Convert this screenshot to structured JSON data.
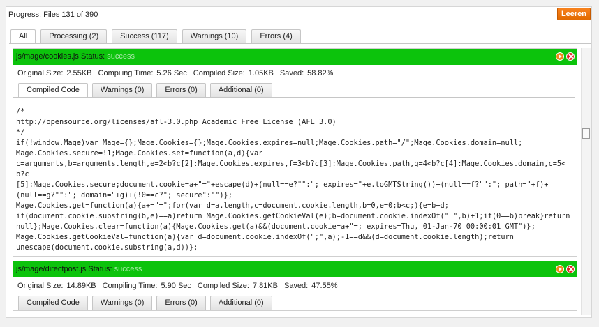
{
  "progress": "Progress: Files 131 of 390",
  "clear_button": "Leeren",
  "main_tabs": [
    {
      "label": "All"
    },
    {
      "label": "Processing (2)"
    },
    {
      "label": "Success (117)"
    },
    {
      "label": "Warnings (10)"
    },
    {
      "label": "Errors (4)"
    }
  ],
  "files": [
    {
      "name": "js/mage/cookies.js",
      "status_label": "Status:",
      "status_value": "success",
      "original_size_label": "Original Size:",
      "original_size": "2.55KB",
      "compiling_time_label": "Compiling Time:",
      "compiling_time": "5.26 Sec",
      "compiled_size_label": "Compiled Size:",
      "compiled_size": "1.05KB",
      "saved_label": "Saved:",
      "saved": "58.82%",
      "tabs": [
        "Compiled Code",
        "Warnings (0)",
        "Errors (0)",
        "Additional (0)"
      ],
      "code": "/*\nhttp://opensource.org/licenses/afl-3.0.php Academic Free License (AFL 3.0)\n*/\nif(!window.Mage)var Mage={};Mage.Cookies={};Mage.Cookies.expires=null;Mage.Cookies.path=\"/\";Mage.Cookies.domain=null;\nMage.Cookies.secure=!1;Mage.Cookies.set=function(a,d){var\nc=arguments,b=arguments.length,e=2<b?c[2]:Mage.Cookies.expires,f=3<b?c[3]:Mage.Cookies.path,g=4<b?c[4]:Mage.Cookies.domain,c=5<b?c\n[5]:Mage.Cookies.secure;document.cookie=a+\"=\"+escape(d)+(null==e?\"\":\"; expires=\"+e.toGMTString())+(null==f?\"\":\"; path=\"+f)+\n(null==g?\"\":\"; domain=\"+g)+(!0==c?\"; secure\":\"\")};\nMage.Cookies.get=function(a){a+=\"=\";for(var d=a.length,c=document.cookie.length,b=0,e=0;b<c;){e=b+d;\nif(document.cookie.substring(b,e)==a)return Mage.Cookies.getCookieVal(e);b=document.cookie.indexOf(\" \",b)+1;if(0==b)break}return\nnull};Mage.Cookies.clear=function(a){Mage.Cookies.get(a)&&(document.cookie=a+\"=; expires=Thu, 01-Jan-70 00:00:01 GMT\")};\nMage.Cookies.getCookieVal=function(a){var d=document.cookie.indexOf(\";\",a);-1==d&&(d=document.cookie.length);return\nunescape(document.cookie.substring(a,d))};"
    },
    {
      "name": "js/mage/directpost.js",
      "status_label": "Status:",
      "status_value": "success",
      "original_size_label": "Original Size:",
      "original_size": "14.89KB",
      "compiling_time_label": "Compiling Time:",
      "compiling_time": "5.90 Sec",
      "compiled_size_label": "Compiled Size:",
      "compiled_size": "7.81KB",
      "saved_label": "Saved:",
      "saved": "47.55%",
      "tabs": [
        "Compiled Code",
        "Warnings (0)",
        "Errors (0)",
        "Additional (0)"
      ]
    }
  ],
  "colors": {
    "header_green": "#0cc30c",
    "clear_orange": "#f08a1c",
    "close_red": "#e02020"
  },
  "icons": [
    "arrow-right-icon",
    "close-icon"
  ]
}
